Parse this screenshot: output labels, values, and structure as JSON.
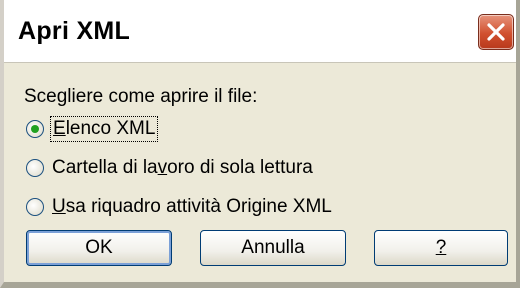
{
  "window": {
    "title": "Apri XML"
  },
  "dialog": {
    "prompt": "Scegliere come aprire il file:",
    "options": [
      {
        "pre": "",
        "accel": "E",
        "post": "lenco XML",
        "checked": true
      },
      {
        "pre": "Cartella di la",
        "accel": "v",
        "post": "oro di sola lettura",
        "checked": false
      },
      {
        "pre": "",
        "accel": "U",
        "post": "sa riquadro attività Origine XML",
        "checked": false
      }
    ]
  },
  "buttons": {
    "ok": "OK",
    "cancel": "Annulla",
    "help": "?"
  },
  "colors": {
    "accent": "#003c74",
    "close": "#d1502f",
    "radio_dot": "#21a121"
  }
}
